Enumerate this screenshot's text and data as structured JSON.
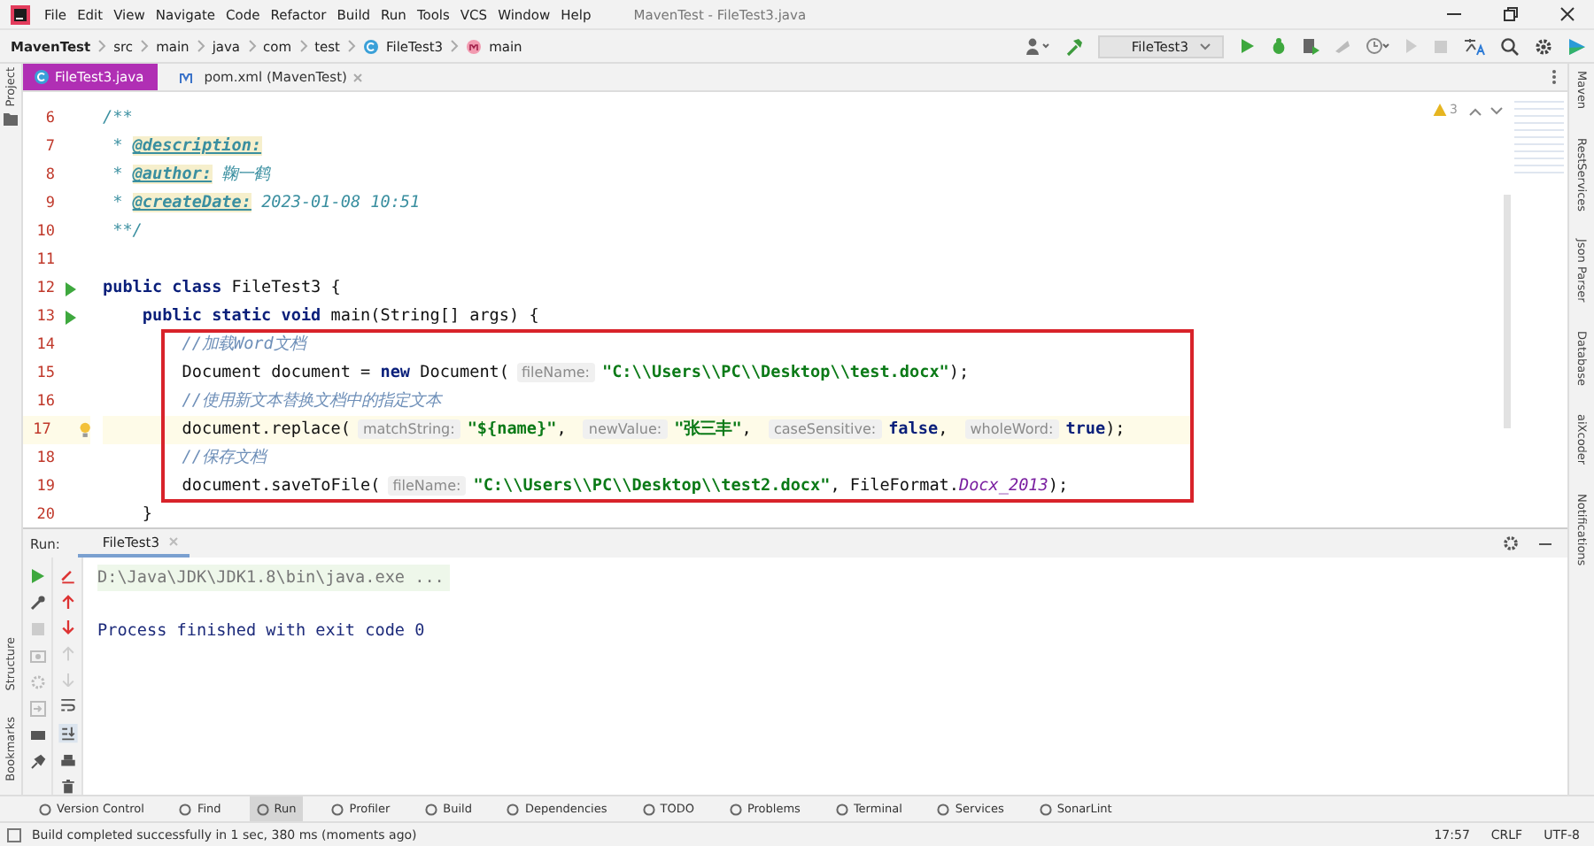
{
  "menu_bar": {
    "items": [
      "File",
      "Edit",
      "View",
      "Navigate",
      "Code",
      "Refactor",
      "Build",
      "Run",
      "Tools",
      "VCS",
      "Window",
      "Help"
    ],
    "title": "MavenTest - FileTest3.java"
  },
  "navigation_bar": {
    "breadcrumbs": [
      {
        "label": "MavenTest",
        "kind": "project"
      },
      {
        "label": "src",
        "kind": "folder"
      },
      {
        "label": "main",
        "kind": "folder"
      },
      {
        "label": "java",
        "kind": "folder"
      },
      {
        "label": "com",
        "kind": "folder"
      },
      {
        "label": "test",
        "kind": "folder"
      },
      {
        "label": "FileTest3",
        "kind": "class"
      },
      {
        "label": "main",
        "kind": "method"
      }
    ],
    "run_config": "FileTest3"
  },
  "left_tool_strip": [
    "Project"
  ],
  "lower_left_tool_strip": [
    "Structure",
    "Bookmarks"
  ],
  "editor_tabs": [
    {
      "label": "FileTest3.java",
      "selected": true,
      "kind": "class"
    },
    {
      "label": "pom.xml (MavenTest)",
      "selected": false,
      "kind": "maven"
    }
  ],
  "editor": {
    "warning_count": "3",
    "blocks": [
      {
        "kind": "plain",
        "lines": [
          {
            "number": "6",
            "run": false,
            "bulb": false,
            "current": false,
            "tokens": [
              {
                "kind": "doc",
                "text": "/**"
              }
            ]
          },
          {
            "number": "7",
            "run": false,
            "bulb": false,
            "current": false,
            "tokens": [
              {
                "kind": "doc",
                "text": " * "
              },
              {
                "kind": "tag",
                "text": "@description:"
              }
            ]
          },
          {
            "number": "8",
            "run": false,
            "bulb": false,
            "current": false,
            "tokens": [
              {
                "kind": "doc",
                "text": " * "
              },
              {
                "kind": "tag",
                "text": "@author:"
              },
              {
                "kind": "doc",
                "text": " 鞠一鹤"
              }
            ]
          },
          {
            "number": "9",
            "run": false,
            "bulb": false,
            "current": false,
            "tokens": [
              {
                "kind": "doc",
                "text": " * "
              },
              {
                "kind": "tag",
                "text": "@createDate:"
              },
              {
                "kind": "doc",
                "text": " 2023-01-08 10:51"
              }
            ]
          },
          {
            "number": "10",
            "run": false,
            "bulb": false,
            "current": false,
            "tokens": [
              {
                "kind": "doc",
                "text": " **/"
              }
            ]
          },
          {
            "number": "11",
            "run": false,
            "bulb": false,
            "current": false
          },
          {
            "number": "12",
            "run": true,
            "bulb": false,
            "current": false,
            "tokens": [
              {
                "kind": "kw",
                "text": "public class "
              },
              {
                "kind": "text",
                "text": "FileTest3 {"
              }
            ]
          },
          {
            "number": "13",
            "run": true,
            "bulb": false,
            "current": false,
            "tokens": [
              {
                "kind": "kw",
                "text": "    public static void "
              },
              {
                "kind": "text",
                "text": "main(String[] args) {"
              }
            ]
          }
        ]
      },
      {
        "kind": "framed",
        "lines": [
          {
            "number": "14",
            "run": false,
            "bulb": false,
            "current": false,
            "tokens": [
              {
                "kind": "comment",
                "text": "        //加载Word文档"
              }
            ]
          },
          {
            "number": "15",
            "run": false,
            "bulb": false,
            "current": false,
            "tokens": [
              {
                "kind": "text",
                "text": "        Document document = "
              },
              {
                "kind": "kw",
                "text": "new "
              },
              {
                "kind": "text",
                "text": "Document("
              },
              {
                "kind": "hint",
                "text": "fileName:"
              },
              {
                "kind": "str",
                "text": "\"C:\\\\Users\\\\PC\\\\Desktop\\\\test.docx\""
              },
              {
                "kind": "text",
                "text": ");"
              }
            ]
          },
          {
            "number": "16",
            "run": false,
            "bulb": false,
            "current": false,
            "tokens": [
              {
                "kind": "comment",
                "text": "        //使用新文本替换文档中的指定文本"
              }
            ]
          },
          {
            "number": "17",
            "run": false,
            "bulb": true,
            "current": true,
            "tokens": [
              {
                "kind": "text",
                "text": "        document.replace("
              },
              {
                "kind": "hint",
                "text": "matchString:"
              },
              {
                "kind": "str",
                "text": "\"${name}\""
              },
              {
                "kind": "text",
                "text": ", "
              },
              {
                "kind": "hint",
                "text": "newValue:"
              },
              {
                "kind": "str",
                "text": "\"张三丰\""
              },
              {
                "kind": "text",
                "text": ", "
              },
              {
                "kind": "hint",
                "text": "caseSensitive:"
              },
              {
                "kind": "kw",
                "text": "false"
              },
              {
                "kind": "text",
                "text": ", "
              },
              {
                "kind": "hint",
                "text": "wholeWord:"
              },
              {
                "kind": "kw",
                "text": "true"
              },
              {
                "kind": "text",
                "text": ");"
              }
            ]
          },
          {
            "number": "18",
            "run": false,
            "bulb": false,
            "current": false,
            "tokens": [
              {
                "kind": "comment",
                "text": "        //保存文档"
              }
            ]
          },
          {
            "number": "19",
            "run": false,
            "bulb": false,
            "current": false,
            "tokens": [
              {
                "kind": "text",
                "text": "        document.saveToFile("
              },
              {
                "kind": "hint",
                "text": "fileName:"
              },
              {
                "kind": "str",
                "text": "\"C:\\\\Users\\\\PC\\\\Desktop\\\\test2.docx\""
              },
              {
                "kind": "text",
                "text": ", FileFormat."
              },
              {
                "kind": "italic",
                "text": "Docx_2013"
              },
              {
                "kind": "text",
                "text": ");"
              }
            ]
          }
        ]
      },
      {
        "kind": "plain",
        "lines": [
          {
            "number": "20",
            "run": false,
            "bulb": false,
            "current": false,
            "tokens": [
              {
                "kind": "text",
                "text": "    }"
              }
            ]
          }
        ]
      }
    ]
  },
  "run_panel": {
    "label": "Run:",
    "tab": "FileTest3",
    "output": [
      {
        "kind": "command",
        "text": "D:\\Java\\JDK\\JDK1.8\\bin\\java.exe ..."
      },
      {
        "kind": "blank"
      },
      {
        "kind": "info",
        "text": "Process finished with exit code 0"
      }
    ]
  },
  "tool_windows": [
    {
      "label": "Version Control",
      "selected": false
    },
    {
      "label": "Find",
      "selected": false
    },
    {
      "label": "Run",
      "selected": true
    },
    {
      "label": "Profiler",
      "selected": false
    },
    {
      "label": "Build",
      "selected": false
    },
    {
      "label": "Dependencies",
      "selected": false
    },
    {
      "label": "TODO",
      "selected": false
    },
    {
      "label": "Problems",
      "selected": false
    },
    {
      "label": "Terminal",
      "selected": false
    },
    {
      "label": "Services",
      "selected": false
    },
    {
      "label": "SonarLint",
      "selected": false
    }
  ],
  "right_tool_strip": [
    "Maven",
    "RestServices",
    "Json Parser",
    "Database",
    "aiXcoder",
    "Notifications"
  ],
  "status_bar": {
    "message": "Build completed successfully in 1 sec, 380 ms (moments ago)",
    "items": [
      "17:57",
      "CRLF",
      "UTF-8"
    ]
  }
}
